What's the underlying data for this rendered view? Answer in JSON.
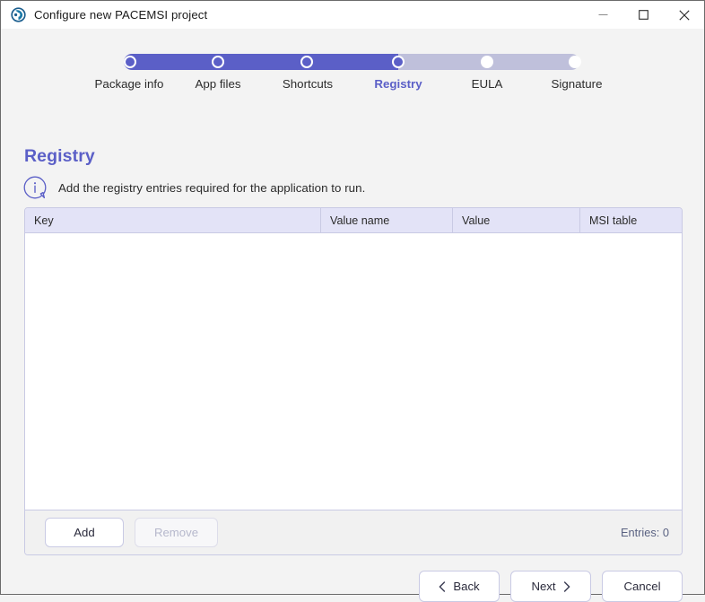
{
  "window": {
    "title": "Configure new PACEMSI project",
    "app_icon": "pacemsi-logo-icon",
    "controls": {
      "minimize": "minimize-icon",
      "maximize": "maximize-icon",
      "close": "close-icon"
    }
  },
  "stepper": {
    "current_index": 3,
    "steps": [
      {
        "label": "Package info",
        "state": "done"
      },
      {
        "label": "App files",
        "state": "done"
      },
      {
        "label": "Shortcuts",
        "state": "done"
      },
      {
        "label": "Registry",
        "state": "active"
      },
      {
        "label": "EULA",
        "state": "todo"
      },
      {
        "label": "Signature",
        "state": "todo"
      }
    ],
    "colors": {
      "fill": "#5b5fc7",
      "track": "#bfc0db",
      "node": "#ffffff"
    }
  },
  "page": {
    "title": "Registry",
    "info_icon": "info-icon",
    "info_text": "Add the registry entries required for the application to run."
  },
  "table": {
    "columns": [
      "Key",
      "Value name",
      "Value",
      "MSI table"
    ],
    "rows": [],
    "footer": {
      "add_label": "Add",
      "remove_label": "Remove",
      "remove_disabled": true,
      "entries_label": "Entries: 0"
    }
  },
  "nav": {
    "back_label": "Back",
    "next_label": "Next",
    "cancel_label": "Cancel",
    "back_icon": "chevron-left-icon",
    "next_icon": "chevron-right-icon"
  }
}
